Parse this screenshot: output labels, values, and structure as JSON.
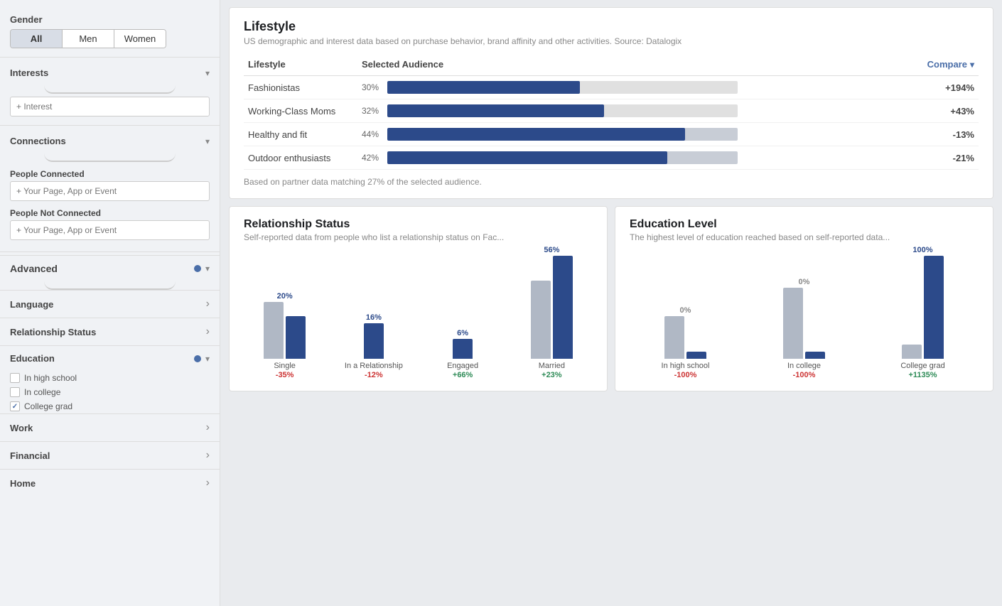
{
  "sidebar": {
    "gender": {
      "label": "Gender",
      "options": [
        "All",
        "Men",
        "Women"
      ],
      "selected": "All"
    },
    "interests": {
      "label": "Interests",
      "placeholder": "+ Interest"
    },
    "connections": {
      "label": "Connections",
      "people_connected_label": "People Connected",
      "people_connected_placeholder": "+ Your Page, App or Event",
      "people_not_connected_label": "People Not Connected",
      "people_not_connected_placeholder": "+ Your Page, App or Event"
    },
    "advanced": {
      "label": "Advanced"
    },
    "nav_items": [
      {
        "id": "language",
        "label": "Language"
      },
      {
        "id": "relationship-status",
        "label": "Relationship Status"
      }
    ],
    "education": {
      "label": "Education",
      "checkboxes": [
        {
          "label": "In high school",
          "checked": false
        },
        {
          "label": "In college",
          "checked": false
        },
        {
          "label": "College grad",
          "checked": true
        }
      ]
    },
    "more_nav": [
      {
        "id": "work",
        "label": "Work"
      },
      {
        "id": "financial",
        "label": "Financial"
      },
      {
        "id": "home",
        "label": "Home"
      }
    ]
  },
  "lifestyle": {
    "title": "Lifestyle",
    "subtitle": "US demographic and interest data based on purchase behavior, brand affinity and other activities. Source: Datalogix",
    "col_lifestyle": "Lifestyle",
    "col_audience": "Selected Audience",
    "col_compare": "Compare",
    "footer": "Based on partner data matching 27% of the selected audience.",
    "rows": [
      {
        "label": "Fashionistas",
        "pct": 30,
        "bar_fill": 55,
        "bar_bg": 28,
        "compare": "+194%",
        "positive": true
      },
      {
        "label": "Working-Class Moms",
        "pct": 32,
        "bar_fill": 62,
        "bar_bg": 40,
        "compare": "+43%",
        "positive": true
      },
      {
        "label": "Healthy and fit",
        "pct": 44,
        "bar_fill": 85,
        "bar_bg": 100,
        "compare": "-13%",
        "positive": false
      },
      {
        "label": "Outdoor enthusiasts",
        "pct": 42,
        "bar_fill": 80,
        "bar_bg": 100,
        "compare": "-21%",
        "positive": false
      }
    ]
  },
  "relationship_status": {
    "title": "Relationship Status",
    "subtitle": "Self-reported data from people who list a relationship status on Fac...",
    "bars": [
      {
        "label": "Single",
        "gray_h": 80,
        "blue_h": 60,
        "blue_pct": "20%",
        "pct_label": "-35%",
        "positive": false
      },
      {
        "label": "In a Relationship",
        "gray_h": 0,
        "blue_h": 50,
        "blue_pct": "16%",
        "pct_label": "-12%",
        "positive": false
      },
      {
        "label": "Engaged",
        "gray_h": 0,
        "blue_h": 28,
        "blue_pct": "6%",
        "pct_label": "+66%",
        "positive": true
      },
      {
        "label": "Married",
        "gray_h": 110,
        "blue_h": 145,
        "blue_pct": "56%",
        "pct_label": "+23%",
        "positive": true
      }
    ]
  },
  "education_level": {
    "title": "Education Level",
    "subtitle": "The highest level of education reached based on self-reported data...",
    "bars": [
      {
        "label": "In high school",
        "gray_h": 60,
        "blue_h": 10,
        "blue_pct": "0%",
        "pct_label": "-100%",
        "positive": false
      },
      {
        "label": "In college",
        "gray_h": 100,
        "blue_h": 10,
        "blue_pct": "0%",
        "pct_label": "-100%",
        "positive": false
      },
      {
        "label": "College grad",
        "gray_h": 20,
        "blue_h": 145,
        "blue_pct": "100%",
        "pct_label": "+1135%",
        "positive": true
      }
    ]
  }
}
